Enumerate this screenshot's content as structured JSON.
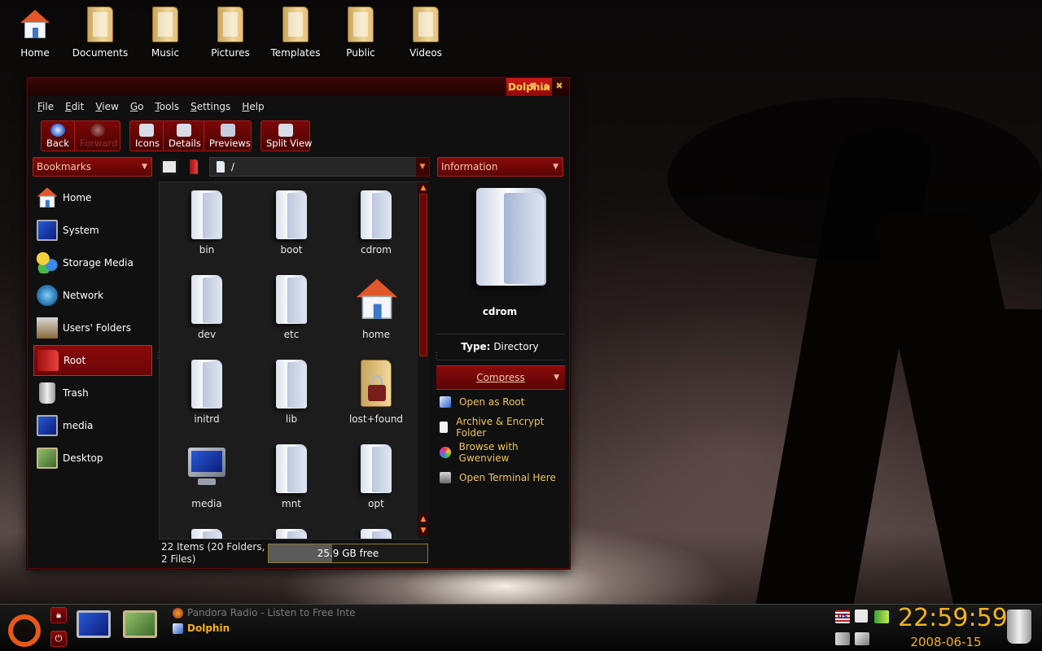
{
  "desktop": {
    "icons": [
      {
        "label": "Home"
      },
      {
        "label": "Documents"
      },
      {
        "label": "Music"
      },
      {
        "label": "Pictures"
      },
      {
        "label": "Templates"
      },
      {
        "label": "Public"
      },
      {
        "label": "Videos"
      }
    ]
  },
  "window": {
    "title": "Dolphin",
    "title_buttons": {
      "minimize": "▼",
      "maximize": "▲",
      "close": "✖"
    },
    "menu": [
      "File",
      "Edit",
      "View",
      "Go",
      "Tools",
      "Settings",
      "Help"
    ],
    "toolbar": {
      "back": "Back",
      "forward": "Forward",
      "icons": "Icons",
      "details": "Details",
      "previews": "Previews",
      "split_view": "Split View"
    },
    "sidebar": {
      "combo_label": "Bookmarks",
      "places": [
        {
          "label": "Home",
          "icon": "home-icon"
        },
        {
          "label": "System",
          "icon": "monitor-icon"
        },
        {
          "label": "Storage Media",
          "icon": "storage-icon"
        },
        {
          "label": "Network",
          "icon": "network-icon"
        },
        {
          "label": "Users' Folders",
          "icon": "users-folder-icon"
        },
        {
          "label": "Root",
          "icon": "root-folder-icon",
          "active": true
        },
        {
          "label": "Trash",
          "icon": "trash-icon"
        },
        {
          "label": "media",
          "icon": "monitor-icon"
        },
        {
          "label": "Desktop",
          "icon": "desktop-icon"
        }
      ]
    },
    "location": {
      "path": "/"
    },
    "files": [
      {
        "name": "bin",
        "icon": "folder"
      },
      {
        "name": "boot",
        "icon": "folder"
      },
      {
        "name": "cdrom",
        "icon": "folder"
      },
      {
        "name": "dev",
        "icon": "folder"
      },
      {
        "name": "etc",
        "icon": "folder"
      },
      {
        "name": "home",
        "icon": "home"
      },
      {
        "name": "initrd",
        "icon": "folder"
      },
      {
        "name": "lib",
        "icon": "folder"
      },
      {
        "name": "lost+found",
        "icon": "locked-folder"
      },
      {
        "name": "media",
        "icon": "monitor"
      },
      {
        "name": "mnt",
        "icon": "folder"
      },
      {
        "name": "opt",
        "icon": "folder"
      }
    ],
    "statusbar": {
      "items_text": "22 Items (20 Folders, 2 Files)",
      "free_space": "25.9 GB free",
      "used_fraction": 0.4
    },
    "info_panel": {
      "combo_label": "Information",
      "name": "cdrom",
      "type_label": "Type:",
      "type_value": "Directory",
      "compress_label": "Compress",
      "actions": [
        {
          "label": "Open as Root",
          "icon": "open-root-icon"
        },
        {
          "label": "Archive & Encrypt Folder",
          "icon": "archive-icon"
        },
        {
          "label": "Browse with Gwenview",
          "icon": "gwenview-icon"
        },
        {
          "label": "Open Terminal Here",
          "icon": "terminal-icon"
        }
      ]
    }
  },
  "panel": {
    "tasks": [
      {
        "label": "Pandora Radio - Listen to Free Inte",
        "icon": "firefox-icon"
      },
      {
        "label": "Dolphin",
        "icon": "dolphin-icon",
        "active": true
      }
    ],
    "clock": "22:59:59",
    "date": "2008-06-15",
    "keyboard_layout": "US",
    "colors": {
      "accent": "#f2b21c",
      "window_red": "#8a0b0b",
      "action_text": "#f0c45a"
    }
  }
}
